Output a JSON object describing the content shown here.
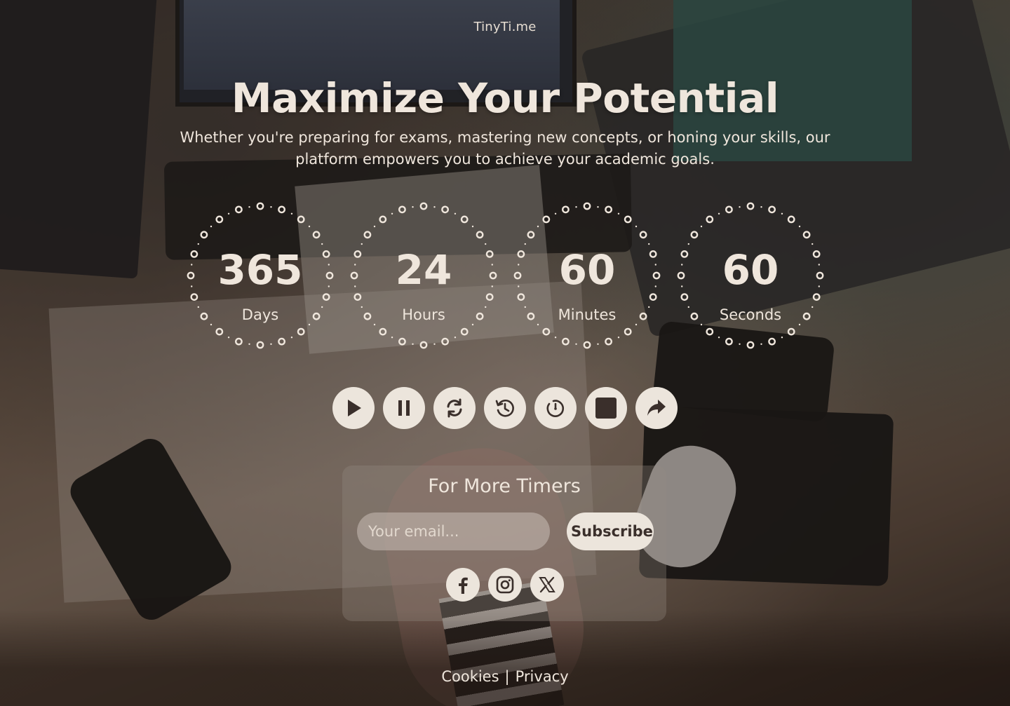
{
  "brand": "TinyTi.me",
  "hero": {
    "title": "Maximize Your Potential",
    "subtitle": "Whether you're preparing for exams, mastering new concepts, or honing your skills, our platform empowers you to achieve your academic goals."
  },
  "countdown": {
    "days": {
      "value": "365",
      "label": "Days"
    },
    "hours": {
      "value": "24",
      "label": "Hours"
    },
    "minutes": {
      "value": "60",
      "label": "Minutes"
    },
    "seconds": {
      "value": "60",
      "label": "Seconds"
    }
  },
  "controls": [
    {
      "name": "play",
      "icon": "play-icon"
    },
    {
      "name": "pause",
      "icon": "pause-icon"
    },
    {
      "name": "reset",
      "icon": "refresh-icon"
    },
    {
      "name": "rewind",
      "icon": "history-icon"
    },
    {
      "name": "timer",
      "icon": "timer-icon"
    },
    {
      "name": "stop",
      "icon": "stop-icon"
    },
    {
      "name": "share",
      "icon": "share-icon"
    }
  ],
  "subscribe": {
    "heading": "For More Timers",
    "email_placeholder": "Your email...",
    "button_label": "Subscribe"
  },
  "social": [
    {
      "name": "facebook",
      "icon": "facebook-icon"
    },
    {
      "name": "instagram",
      "icon": "instagram-icon"
    },
    {
      "name": "x",
      "icon": "x-icon"
    }
  ],
  "footer": {
    "cookies": "Cookies",
    "separator": "|",
    "privacy": "Privacy"
  },
  "colors": {
    "button_bg": "#ece5dc",
    "icon_color": "#3a2f2b",
    "text": "#efe6dc"
  }
}
